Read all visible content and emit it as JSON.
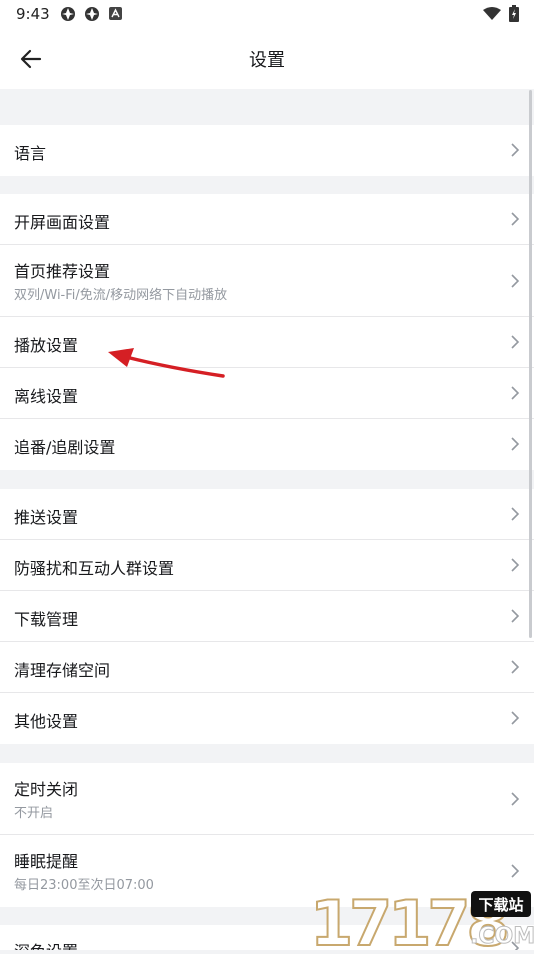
{
  "status_bar": {
    "time": "9:43"
  },
  "header": {
    "title": "设置"
  },
  "groups": [
    {
      "items": [
        {
          "label": "语言"
        }
      ]
    },
    {
      "items": [
        {
          "label": "开屏画面设置"
        },
        {
          "label": "首页推荐设置",
          "sub": "双列/Wi-Fi/免流/移动网络下自动播放"
        },
        {
          "label": "播放设置"
        },
        {
          "label": "离线设置"
        },
        {
          "label": "追番/追剧设置"
        }
      ]
    },
    {
      "items": [
        {
          "label": "推送设置"
        },
        {
          "label": "防骚扰和互动人群设置"
        },
        {
          "label": "下载管理"
        },
        {
          "label": "清理存储空间"
        },
        {
          "label": "其他设置"
        }
      ]
    },
    {
      "items": [
        {
          "label": "定时关闭",
          "sub": "不开启"
        },
        {
          "label": "睡眠提醒",
          "sub": "每日23:00至次日07:00"
        }
      ]
    },
    {
      "items": [
        {
          "label": "深色设置"
        }
      ]
    }
  ],
  "watermark": {
    "text": "17178",
    "badge": "下载站",
    "suffix": ".COM"
  },
  "colors": {
    "annotation_arrow": "#d51f24",
    "chevron": "#9499a0",
    "background": "#f2f3f5"
  }
}
